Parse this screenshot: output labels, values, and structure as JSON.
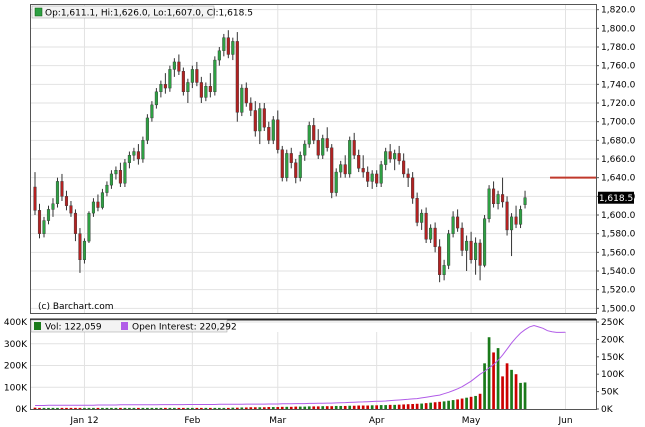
{
  "chart_data": {
    "type": "candlestick",
    "ohlc_legend": {
      "label": "Op:1,611.1, Hi:1,626.0, Lo:1,607.0, Cl:1,618.5"
    },
    "last_price_label": "1,618.5",
    "last_price": 1618.5,
    "watermark": "(c) Barchart.com",
    "x_tick_labels": [
      "Jan 12",
      "Feb",
      "Mar",
      "Apr",
      "May",
      "Jun"
    ],
    "x_tick_positions": [
      11,
      35,
      54,
      76,
      97,
      118
    ],
    "price_axis": {
      "min": 1495,
      "max": 1825,
      "ticks": [
        1500,
        1520,
        1540,
        1560,
        1580,
        1600,
        1620,
        1640,
        1660,
        1680,
        1700,
        1720,
        1740,
        1760,
        1780,
        1800,
        1820
      ],
      "tick_labels": [
        "1,500.0",
        "1,520.0",
        "1,540.0",
        "1,560.0",
        "1,580.0",
        "1,600.0",
        "1,620.0",
        "1,640.0",
        "1,660.0",
        "1,680.0",
        "1,700.0",
        "1,720.0",
        "1,740.0",
        "1,760.0",
        "1,780.0",
        "1,800.0",
        "1,820.0"
      ]
    },
    "resistance_level": 1640,
    "resistance_start_index": 115,
    "resistance_color": "#c0392b",
    "up_color": "#2ea043",
    "down_color": "#b22222",
    "candles": [
      [
        1630,
        1646,
        1600,
        1605
      ],
      [
        1605,
        1612,
        1575,
        1580
      ],
      [
        1580,
        1598,
        1576,
        1594
      ],
      [
        1594,
        1610,
        1590,
        1606
      ],
      [
        1606,
        1618,
        1598,
        1612
      ],
      [
        1612,
        1640,
        1608,
        1636
      ],
      [
        1636,
        1644,
        1615,
        1620
      ],
      [
        1620,
        1626,
        1605,
        1610
      ],
      [
        1610,
        1615,
        1598,
        1602
      ],
      [
        1602,
        1606,
        1572,
        1580
      ],
      [
        1580,
        1586,
        1538,
        1552
      ],
      [
        1552,
        1575,
        1548,
        1572
      ],
      [
        1572,
        1604,
        1570,
        1602
      ],
      [
        1602,
        1618,
        1598,
        1614
      ],
      [
        1614,
        1622,
        1604,
        1608
      ],
      [
        1608,
        1628,
        1606,
        1624
      ],
      [
        1624,
        1636,
        1620,
        1632
      ],
      [
        1632,
        1648,
        1628,
        1644
      ],
      [
        1644,
        1652,
        1638,
        1648
      ],
      [
        1648,
        1656,
        1630,
        1634
      ],
      [
        1634,
        1660,
        1630,
        1656
      ],
      [
        1656,
        1668,
        1650,
        1664
      ],
      [
        1664,
        1672,
        1658,
        1668
      ],
      [
        1668,
        1676,
        1654,
        1660
      ],
      [
        1660,
        1684,
        1656,
        1680
      ],
      [
        1680,
        1708,
        1676,
        1704
      ],
      [
        1704,
        1722,
        1700,
        1718
      ],
      [
        1718,
        1736,
        1714,
        1732
      ],
      [
        1732,
        1744,
        1726,
        1740
      ],
      [
        1740,
        1752,
        1730,
        1736
      ],
      [
        1736,
        1760,
        1732,
        1756
      ],
      [
        1756,
        1768,
        1748,
        1764
      ],
      [
        1764,
        1772,
        1750,
        1754
      ],
      [
        1754,
        1758,
        1728,
        1732
      ],
      [
        1732,
        1746,
        1720,
        1742
      ],
      [
        1742,
        1760,
        1736,
        1756
      ],
      [
        1756,
        1764,
        1738,
        1742
      ],
      [
        1742,
        1748,
        1720,
        1726
      ],
      [
        1726,
        1742,
        1722,
        1738
      ],
      [
        1738,
        1752,
        1726,
        1732
      ],
      [
        1732,
        1770,
        1728,
        1766
      ],
      [
        1766,
        1780,
        1760,
        1776
      ],
      [
        1776,
        1794,
        1770,
        1790
      ],
      [
        1790,
        1798,
        1768,
        1772
      ],
      [
        1772,
        1790,
        1766,
        1786
      ],
      [
        1786,
        1796,
        1700,
        1710
      ],
      [
        1710,
        1740,
        1706,
        1736
      ],
      [
        1736,
        1742,
        1716,
        1720
      ],
      [
        1720,
        1726,
        1706,
        1712
      ],
      [
        1712,
        1722,
        1684,
        1690
      ],
      [
        1690,
        1720,
        1676,
        1714
      ],
      [
        1714,
        1720,
        1690,
        1694
      ],
      [
        1694,
        1700,
        1676,
        1680
      ],
      [
        1680,
        1706,
        1676,
        1702
      ],
      [
        1702,
        1712,
        1666,
        1670
      ],
      [
        1670,
        1674,
        1636,
        1640
      ],
      [
        1640,
        1670,
        1636,
        1666
      ],
      [
        1666,
        1672,
        1650,
        1656
      ],
      [
        1656,
        1660,
        1634,
        1640
      ],
      [
        1640,
        1668,
        1636,
        1664
      ],
      [
        1664,
        1680,
        1658,
        1676
      ],
      [
        1676,
        1700,
        1672,
        1696
      ],
      [
        1696,
        1704,
        1676,
        1680
      ],
      [
        1680,
        1692,
        1660,
        1664
      ],
      [
        1664,
        1686,
        1660,
        1682
      ],
      [
        1682,
        1694,
        1668,
        1672
      ],
      [
        1672,
        1676,
        1618,
        1624
      ],
      [
        1624,
        1650,
        1620,
        1646
      ],
      [
        1646,
        1658,
        1640,
        1654
      ],
      [
        1654,
        1664,
        1640,
        1644
      ],
      [
        1644,
        1684,
        1640,
        1680
      ],
      [
        1680,
        1688,
        1660,
        1664
      ],
      [
        1664,
        1670,
        1646,
        1650
      ],
      [
        1650,
        1664,
        1640,
        1646
      ],
      [
        1646,
        1652,
        1630,
        1636
      ],
      [
        1636,
        1648,
        1628,
        1644
      ],
      [
        1644,
        1648,
        1630,
        1634
      ],
      [
        1634,
        1658,
        1630,
        1654
      ],
      [
        1654,
        1672,
        1648,
        1668
      ],
      [
        1668,
        1676,
        1656,
        1660
      ],
      [
        1660,
        1670,
        1648,
        1666
      ],
      [
        1666,
        1674,
        1654,
        1658
      ],
      [
        1658,
        1666,
        1640,
        1644
      ],
      [
        1644,
        1650,
        1630,
        1640
      ],
      [
        1640,
        1646,
        1612,
        1618
      ],
      [
        1618,
        1624,
        1588,
        1592
      ],
      [
        1592,
        1606,
        1584,
        1602
      ],
      [
        1602,
        1608,
        1570,
        1574
      ],
      [
        1574,
        1590,
        1570,
        1586
      ],
      [
        1586,
        1592,
        1560,
        1566
      ],
      [
        1566,
        1574,
        1528,
        1536
      ],
      [
        1536,
        1552,
        1530,
        1546
      ],
      [
        1546,
        1584,
        1542,
        1580
      ],
      [
        1580,
        1604,
        1576,
        1598
      ],
      [
        1598,
        1606,
        1582,
        1586
      ],
      [
        1586,
        1592,
        1556,
        1562
      ],
      [
        1562,
        1578,
        1540,
        1572
      ],
      [
        1572,
        1582,
        1548,
        1552
      ],
      [
        1552,
        1576,
        1536,
        1570
      ],
      [
        1570,
        1574,
        1530,
        1546
      ],
      [
        1546,
        1600,
        1544,
        1596
      ],
      [
        1596,
        1632,
        1592,
        1628
      ],
      [
        1628,
        1636,
        1608,
        1612
      ],
      [
        1612,
        1626,
        1606,
        1622
      ],
      [
        1622,
        1640,
        1608,
        1614
      ],
      [
        1614,
        1620,
        1578,
        1584
      ],
      [
        1584,
        1602,
        1556,
        1598
      ],
      [
        1598,
        1610,
        1586,
        1590
      ],
      [
        1590,
        1610,
        1586,
        1606
      ],
      [
        1611.1,
        1626,
        1607,
        1618.5
      ]
    ],
    "volume_axis": {
      "ticks": [
        0,
        100000,
        200000,
        300000,
        400000
      ],
      "tick_labels": [
        "0K",
        "100K",
        "200K",
        "300K",
        "400K"
      ],
      "max": 400000
    },
    "oi_axis": {
      "ticks": [
        0,
        50000,
        100000,
        150000,
        200000,
        250000
      ],
      "tick_labels": [
        "0K",
        "50K",
        "100K",
        "150K",
        "200K",
        "250K"
      ],
      "max": 250000
    },
    "volume_legend": "Vol: 122,059",
    "oi_legend": "Open Interest: 220,292",
    "volume_color": "#1a7a1a",
    "volume_down_color": "#cc0000",
    "oi_color": "#b15ce8",
    "volume": [
      6000,
      5000,
      5000,
      5000,
      5000,
      5000,
      5000,
      5000,
      5000,
      5000,
      5000,
      5000,
      5000,
      5000,
      5000,
      5000,
      5000,
      5000,
      5000,
      5000,
      5000,
      5000,
      5000,
      5000,
      5000,
      5000,
      5000,
      5000,
      5000,
      5000,
      5000,
      5000,
      5000,
      5000,
      5000,
      5000,
      5000,
      5000,
      5000,
      5000,
      5000,
      5000,
      5000,
      5000,
      6000,
      6000,
      7000,
      7000,
      8000,
      8000,
      8000,
      8000,
      9000,
      9000,
      9000,
      10000,
      10000,
      10000,
      11000,
      11000,
      11000,
      12000,
      12000,
      12000,
      13000,
      13000,
      13000,
      14000,
      14000,
      14000,
      15000,
      15000,
      16000,
      16000,
      16000,
      17000,
      17000,
      18000,
      18000,
      19000,
      19000,
      20000,
      21000,
      22000,
      23000,
      24000,
      25000,
      27000,
      29000,
      31000,
      33000,
      35000,
      38000,
      41000,
      44000,
      48000,
      52000,
      56000,
      60000,
      70000,
      210000,
      330000,
      260000,
      280000,
      150000,
      210000,
      180000,
      160000,
      120000,
      122059
    ],
    "open_interest": [
      10000,
      10000,
      10000,
      10500,
      10500,
      10500,
      11000,
      11000,
      11000,
      11000,
      11000,
      11000,
      11000,
      11000,
      11500,
      11500,
      11500,
      11500,
      11500,
      12000,
      12000,
      12000,
      12000,
      12000,
      12000,
      12000,
      12000,
      12000,
      12500,
      12500,
      12500,
      12500,
      12500,
      12500,
      13000,
      13000,
      13000,
      13000,
      13000,
      13000,
      13000,
      13500,
      13500,
      13500,
      13500,
      13500,
      13500,
      14000,
      14000,
      14000,
      14000,
      14000,
      14500,
      14500,
      14500,
      15000,
      15000,
      15000,
      15500,
      15500,
      15500,
      16000,
      16000,
      16500,
      16500,
      17000,
      17000,
      17500,
      18000,
      18500,
      19000,
      19500,
      20000,
      20500,
      21000,
      21500,
      22000,
      22500,
      23000,
      24000,
      25000,
      26000,
      27000,
      28000,
      29000,
      30000,
      32000,
      34000,
      36000,
      38000,
      40000,
      44000,
      48000,
      53000,
      58000,
      64000,
      72000,
      80000,
      90000,
      100000,
      108000,
      118000,
      128000,
      140000,
      155000,
      172000,
      190000,
      205000,
      218000,
      228000,
      236000,
      240000,
      236000,
      232000,
      225000,
      222000,
      220000,
      220000,
      220292
    ]
  }
}
